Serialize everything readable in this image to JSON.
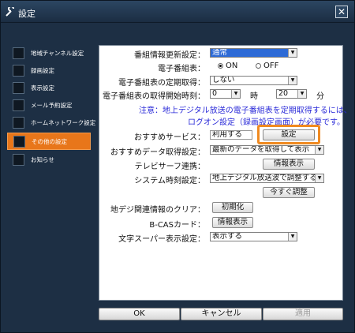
{
  "window": {
    "title": "設定",
    "close_symbol": "✕"
  },
  "sidebar": {
    "items": [
      {
        "label": "地域チャンネル設定",
        "icon": "globe-icon"
      },
      {
        "label": "録画設定",
        "icon": "record-icon"
      },
      {
        "label": "表示設定",
        "icon": "display-icon"
      },
      {
        "label": "メール予約設定",
        "icon": "mail-icon"
      },
      {
        "label": "ホームネットワーク設定",
        "icon": "network-icon"
      },
      {
        "label": "その他の設定",
        "icon": "wrench-icon",
        "active": true
      },
      {
        "label": "お知らせ",
        "icon": "info-icon"
      }
    ]
  },
  "form": {
    "epg_update": {
      "label": "番組情報更新設定：",
      "value": "通常"
    },
    "epg": {
      "label": "電子番組表：",
      "on": "ON",
      "off": "OFF",
      "selected": "on"
    },
    "epg_periodic": {
      "label": "電子番組表の定期取得：",
      "value": "しない"
    },
    "epg_start": {
      "label": "電子番組表の取得開始時刻：",
      "hour": "0",
      "hour_unit": "時",
      "minute": "20",
      "minute_unit": "分"
    },
    "note_line1": "注意：地上デジタル放送の電子番組表を定期取得するには、",
    "note_line2": "ログオン設定（録画設定画面）が必要です。",
    "recommend_service": {
      "label": "おすすめサービス：",
      "value": "利用する",
      "button": "設定"
    },
    "recommend_data": {
      "label": "おすすめデータ取得設定：",
      "value": "最新のデータを取得して表示"
    },
    "telesurf": {
      "label": "テレビサーフ連携：",
      "button": "情報表示"
    },
    "system_clock": {
      "label": "システム時刻設定：",
      "value": "地上デジタル放送波で調整する",
      "button": "今すぐ調整"
    },
    "digital_clear": {
      "label": "地デジ関連情報のクリア：",
      "button": "初期化"
    },
    "bcas": {
      "label": "B-CASカード：",
      "button": "情報表示"
    },
    "super_text": {
      "label": "文字スーパー表示設定：",
      "value": "表示する"
    }
  },
  "footer": {
    "ok": "OK",
    "cancel": "キャンセル",
    "apply": "適用"
  },
  "colors": {
    "accent": "#e8761a",
    "window_bg": "#1d2f44",
    "note_text": "#2a2ad8",
    "selected_bg": "#2d6ad6"
  }
}
